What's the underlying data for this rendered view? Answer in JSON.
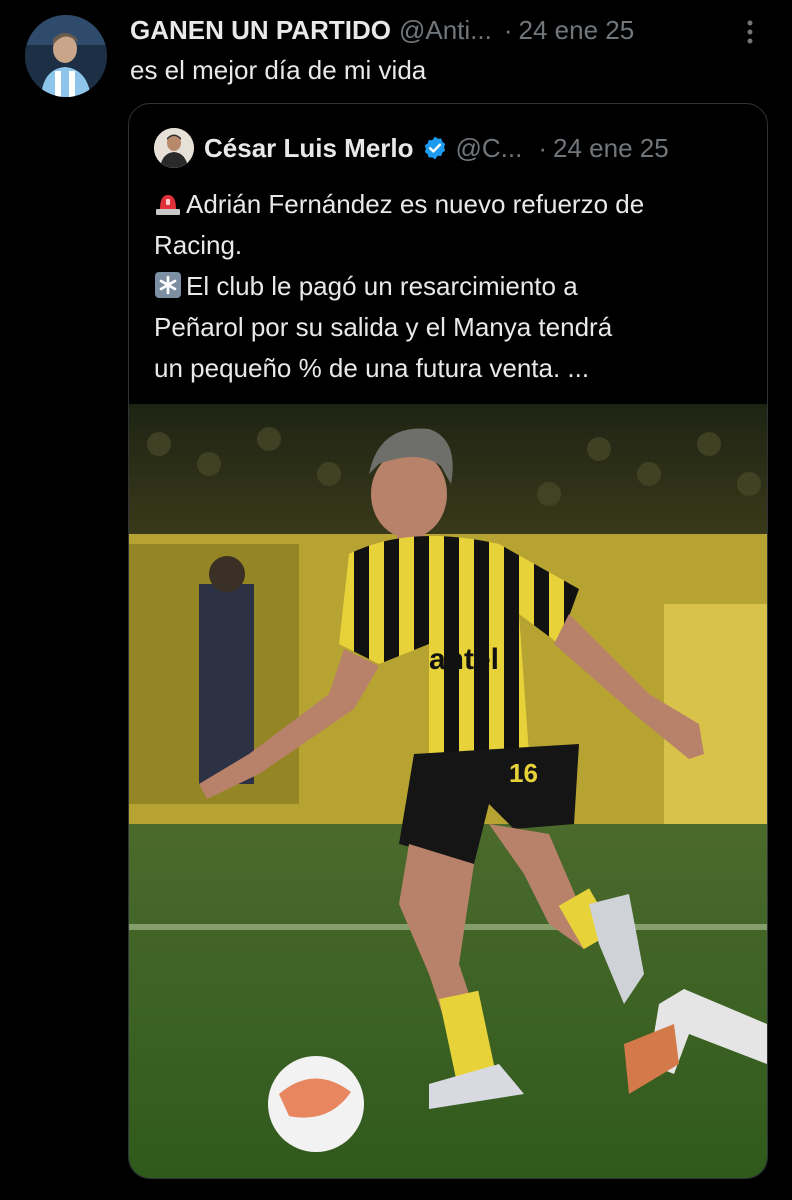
{
  "tweet": {
    "author_name": "GANEN UN PARTIDO",
    "handle": "@Anti...",
    "separator": "·",
    "time": "24 ene 25",
    "text": "es el mejor día de mi vida"
  },
  "quoted_tweet": {
    "author_name": "César Luis Merlo",
    "handle": "@C...",
    "separator": "·",
    "time": "24 ene 25",
    "lines": [
      "Adrián Fernández es nuevo refuerzo de",
      "Racing.",
      "El club le pagó un resarcimiento a",
      "Peñarol por su salida y el Manya tendrá",
      "un pequeño % de una futura venta. ..."
    ],
    "emojis": [
      "police-light-icon",
      "asterisk-icon"
    ],
    "media": {
      "sponsor_text": "antel",
      "shirt_number": "16"
    }
  },
  "colors": {
    "background": "#000000",
    "primary_text": "#e7e9ea",
    "secondary_text": "#71767b",
    "border": "#2f3336",
    "verified_blue": "#1d9bf0"
  }
}
